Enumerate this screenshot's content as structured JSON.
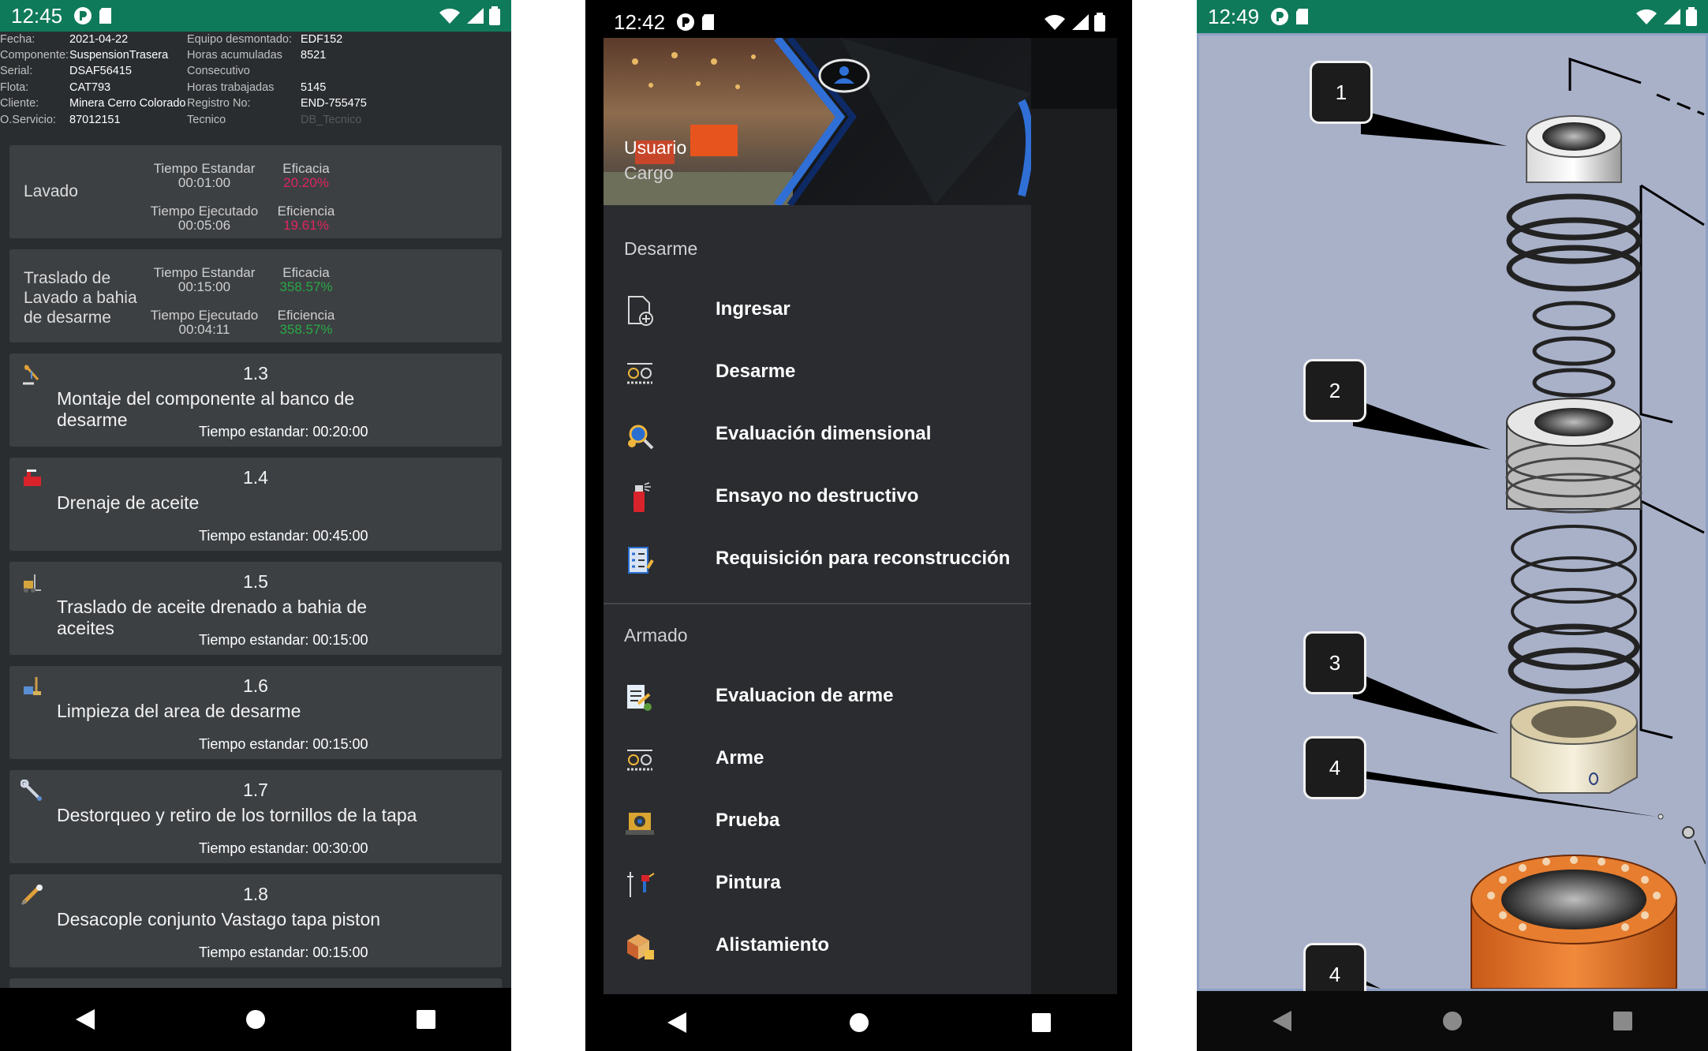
{
  "phone1": {
    "status": {
      "time": "12:45"
    },
    "info": {
      "left": [
        {
          "k": "Fecha:",
          "v": "2021-04-22"
        },
        {
          "k": "Componente:",
          "v": "SuspensionTrasera"
        },
        {
          "k": "Serial:",
          "v": "DSAF56415"
        },
        {
          "k": "Flota:",
          "v": "CAT793"
        },
        {
          "k": "Cliente:",
          "v": "Minera Cerro Colorado"
        },
        {
          "k": "O.Servicio:",
          "v": "87012151"
        }
      ],
      "right": [
        {
          "k": "Equipo desmontado:",
          "v": "EDF152"
        },
        {
          "k": "Horas acumuladas",
          "v": "8521"
        },
        {
          "k": "Consecutivo",
          "v": ""
        },
        {
          "k": "Horas trabajadas",
          "v": "5145"
        },
        {
          "k": "Registro No:",
          "v": "END-755475"
        },
        {
          "k": "Tecnico",
          "v": "DB_Tecnico"
        }
      ]
    },
    "summary": [
      {
        "label": "Lavado",
        "std_label": "Tiempo Estandar",
        "std": "00:01:00",
        "exec_label": "Tiempo Ejecutado",
        "exec": "00:05:06",
        "eficacia_label": "Eficacia",
        "eficacia": "20.20%",
        "eficiencia_label": "Eficiencia",
        "eficiencia": "19.61%",
        "status_color": "#e0245e"
      },
      {
        "label": "Traslado de Lavado a bahia de desarme",
        "std_label": "Tiempo Estandar",
        "std": "00:15:00",
        "exec_label": "Tiempo Ejecutado",
        "exec": "00:04:11",
        "eficacia_label": "Eficacia",
        "eficacia": "358.57%",
        "eficiencia_label": "Eficiencia",
        "eficiencia": "358.57%",
        "status_color": "#27a844"
      }
    ],
    "tasks": [
      {
        "num": "1.3",
        "title": "Montaje del componente al banco de desarme",
        "std": "Tiempo estandar: 00:20:00",
        "icon": "crane-icon"
      },
      {
        "num": "1.4",
        "title": "Drenaje de aceite",
        "std": "Tiempo estandar: 00:45:00",
        "icon": "oil-drain-icon"
      },
      {
        "num": "1.5",
        "title": "Traslado de aceite drenado a bahia de aceites",
        "std": "Tiempo estandar: 00:15:00",
        "icon": "forklift-icon"
      },
      {
        "num": "1.6",
        "title": "Limpieza del area de desarme",
        "std": "Tiempo estandar: 00:15:00",
        "icon": "cleaning-icon"
      },
      {
        "num": "1.7",
        "title": "Destorqueo y retiro de los tornillos de la tapa",
        "std": "Tiempo estandar: 00:30:00",
        "icon": "wrench-icon"
      },
      {
        "num": "1.8",
        "title": "Desacople conjunto Vastago tapa piston",
        "std": "Tiempo estandar: 00:15:00",
        "icon": "hydraulic-icon"
      }
    ]
  },
  "phone2": {
    "status": {
      "time": "12:42"
    },
    "header": {
      "user": "Usuario",
      "role": "Cargo"
    },
    "sections": [
      {
        "title": "Desarme",
        "items": [
          {
            "label": "Ingresar",
            "icon": "add-document-icon"
          },
          {
            "label": "Desarme",
            "icon": "disassembly-icon"
          },
          {
            "label": "Evaluación dimensional",
            "icon": "gear-search-icon"
          },
          {
            "label": "Ensayo no destructivo",
            "icon": "spray-can-icon"
          },
          {
            "label": "Requisición para reconstrucción",
            "icon": "checklist-icon"
          }
        ]
      },
      {
        "title": "Armado",
        "items": [
          {
            "label": "Evaluacion de arme",
            "icon": "evaluation-icon"
          },
          {
            "label": "Arme",
            "icon": "assembly-icon"
          },
          {
            "label": "Prueba",
            "icon": "test-machine-icon"
          },
          {
            "label": "Pintura",
            "icon": "paint-gun-icon"
          },
          {
            "label": "Alistamiento",
            "icon": "boxes-icon"
          }
        ]
      }
    ]
  },
  "phone3": {
    "status": {
      "time": "12:49"
    },
    "callouts": [
      "1",
      "2",
      "3",
      "4",
      "4"
    ]
  },
  "colors": {
    "statusbar": "#0f7a5a",
    "red": "#e0245e",
    "green": "#27a844"
  }
}
